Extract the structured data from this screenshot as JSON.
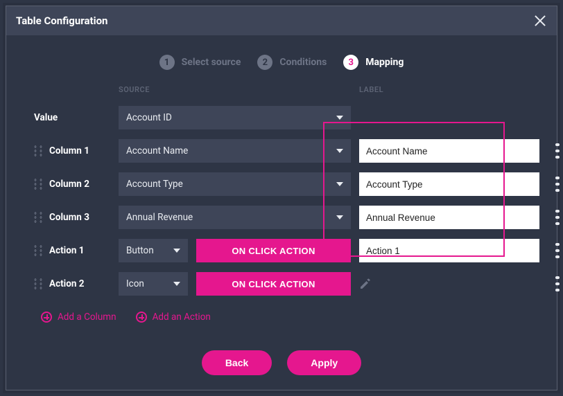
{
  "header": {
    "title": "Table Configuration"
  },
  "steps": [
    {
      "num": "1",
      "label": "Select source"
    },
    {
      "num": "2",
      "label": "Conditions"
    },
    {
      "num": "3",
      "label": "Mapping"
    }
  ],
  "columns_header": {
    "source": "SOURCE",
    "label": "LABEL"
  },
  "value_row": {
    "name": "Value",
    "source": "Account ID"
  },
  "rows": [
    {
      "name": "Column 1",
      "source": "Account Name",
      "label": "Account Name"
    },
    {
      "name": "Column 2",
      "source": "Account Type",
      "label": "Account Type"
    },
    {
      "name": "Column 3",
      "source": "Annual Revenue",
      "label": "Annual Revenue"
    }
  ],
  "actions": [
    {
      "name": "Action 1",
      "type": "Button",
      "button": "ON CLICK ACTION",
      "label": "Action 1"
    },
    {
      "name": "Action 2",
      "type": "Icon",
      "button": "ON CLICK ACTION"
    }
  ],
  "add": {
    "column": "Add a Column",
    "action": "Add an Action"
  },
  "footer": {
    "back": "Back",
    "apply": "Apply"
  }
}
